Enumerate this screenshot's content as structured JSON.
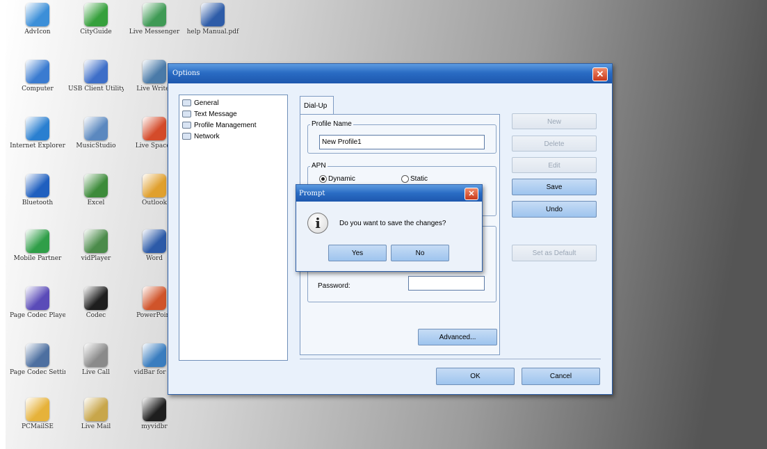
{
  "desktop": {
    "icons": [
      {
        "label": "AdvIcon",
        "name": "desktop-icon-1",
        "color": "#3c8fd8"
      },
      {
        "label": "CityGuide",
        "name": "desktop-icon-2",
        "color": "#36a03c"
      },
      {
        "label": "Live Messenger",
        "name": "desktop-icon-3",
        "color": "#3f9a55"
      },
      {
        "label": "help\nManual.pdf",
        "name": "desktop-icon-4",
        "color": "#2e5ca8"
      },
      {
        "label": "Computer",
        "name": "desktop-icon-5",
        "color": "#3a7bd0"
      },
      {
        "label": "USB Client Utility",
        "name": "desktop-icon-6",
        "color": "#3d6ec8"
      },
      {
        "label": "Live Writer",
        "name": "desktop-icon-7",
        "color": "#4a7aa8"
      },
      {
        "label": "Internet Explorer",
        "name": "desktop-icon-8",
        "color": "#2a7fd0"
      },
      {
        "label": "MusicStudio",
        "name": "desktop-icon-9",
        "color": "#5b88bf"
      },
      {
        "label": "Live Spaces",
        "name": "desktop-icon-10",
        "color": "#d44b2a"
      },
      {
        "label": "Bluetooth",
        "name": "desktop-icon-11",
        "color": "#1f5fbf"
      },
      {
        "label": "Excel",
        "name": "desktop-icon-12",
        "color": "#3d8b3a"
      },
      {
        "label": "Outlook",
        "name": "desktop-icon-13",
        "color": "#e0a02e"
      },
      {
        "label": "Mobile Partner",
        "name": "desktop-icon-14",
        "color": "#2f9e48"
      },
      {
        "label": "vidPlayer",
        "name": "desktop-icon-15",
        "color": "#4b8b4a"
      },
      {
        "label": "Word",
        "name": "desktop-icon-16",
        "color": "#2c5aa8"
      },
      {
        "label": "Page Codec Player",
        "name": "desktop-icon-17",
        "color": "#5a4bb8"
      },
      {
        "label": "Codec",
        "name": "desktop-icon-18",
        "color": "#1e1e1e"
      },
      {
        "label": "PowerPoint",
        "name": "desktop-icon-19",
        "color": "#d0542a"
      },
      {
        "label": "Page Codec Settings",
        "name": "desktop-icon-20",
        "color": "#4d6fa0"
      },
      {
        "label": "Live Call",
        "name": "desktop-icon-21",
        "color": "#8a8a8a"
      },
      {
        "label": "vidBar for IE",
        "name": "desktop-icon-22",
        "color": "#3a7dbf"
      },
      {
        "label": "PCMailSE",
        "name": "desktop-icon-23",
        "color": "#e6b23a"
      },
      {
        "label": "Live Mail",
        "name": "desktop-icon-24",
        "color": "#c8a64a"
      },
      {
        "label": "myvidbr",
        "name": "desktop-icon-25",
        "color": "#1e1e1e"
      }
    ]
  },
  "options_window": {
    "title": "Options",
    "close_glyph": "✕",
    "tree": [
      "General",
      "Text Message",
      "Profile Management",
      "Network"
    ],
    "tab_label": "Dial-Up",
    "profile_group_label": "Profile Name",
    "profile_name_value": "New Profile1",
    "apn_group_label": "APN",
    "apn_dynamic": "Dynamic",
    "apn_static": "Static",
    "password_label": "Password:",
    "password_value": "",
    "advanced_label": "Advanced...",
    "buttons": {
      "new": "New",
      "delete": "Delete",
      "edit": "Edit",
      "save": "Save",
      "undo": "Undo",
      "set_default": "Set as Default",
      "ok": "OK",
      "cancel": "Cancel"
    }
  },
  "prompt_dialog": {
    "title": "Prompt",
    "close_glyph": "✕",
    "icon": "info-icon",
    "icon_glyph": "i",
    "message": "Do you want to save the changes?",
    "yes": "Yes",
    "no": "No"
  }
}
